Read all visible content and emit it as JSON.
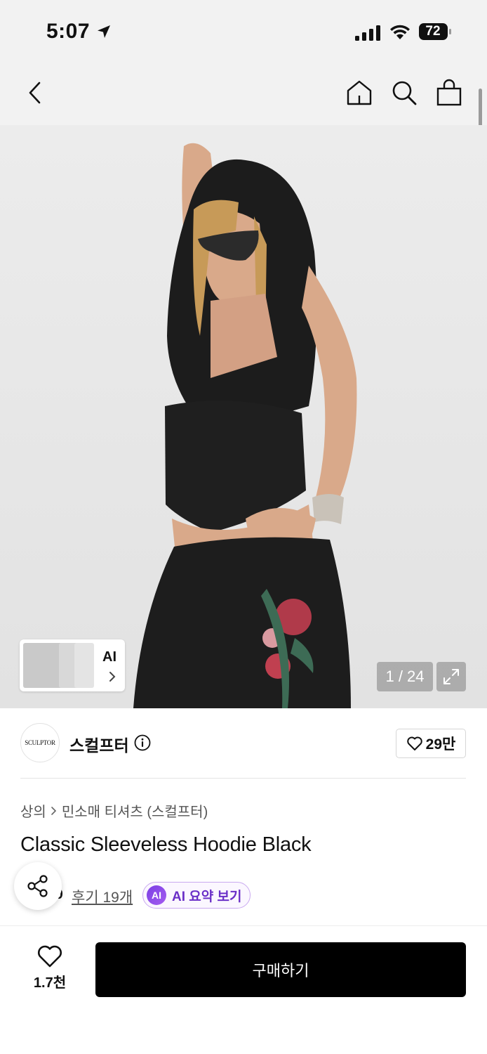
{
  "status_bar": {
    "time": "5:07",
    "battery": "72"
  },
  "nav": {
    "icons": [
      "back-icon",
      "home-icon",
      "search-icon",
      "bag-icon"
    ]
  },
  "gallery": {
    "ai_label": "AI",
    "counter": "1 / 24"
  },
  "brand": {
    "logo_text": "SCULPTOR",
    "name": "스컬프터",
    "followers": "29만"
  },
  "product": {
    "breadcrumb": [
      "상의",
      "민소매 티셔츠 (스컬프터)"
    ],
    "title": "Classic Sleeveless Hoodie Black",
    "rating": "4.9",
    "reviews": "후기 19개",
    "ai_badge": "AI",
    "ai_summary_label": "AI 요약 보기"
  },
  "bottom_bar": {
    "wish_count": "1.7천",
    "buy_label": "구매하기"
  },
  "colors": {
    "accent": "#7b3fe4",
    "buy_button": "#000000"
  }
}
